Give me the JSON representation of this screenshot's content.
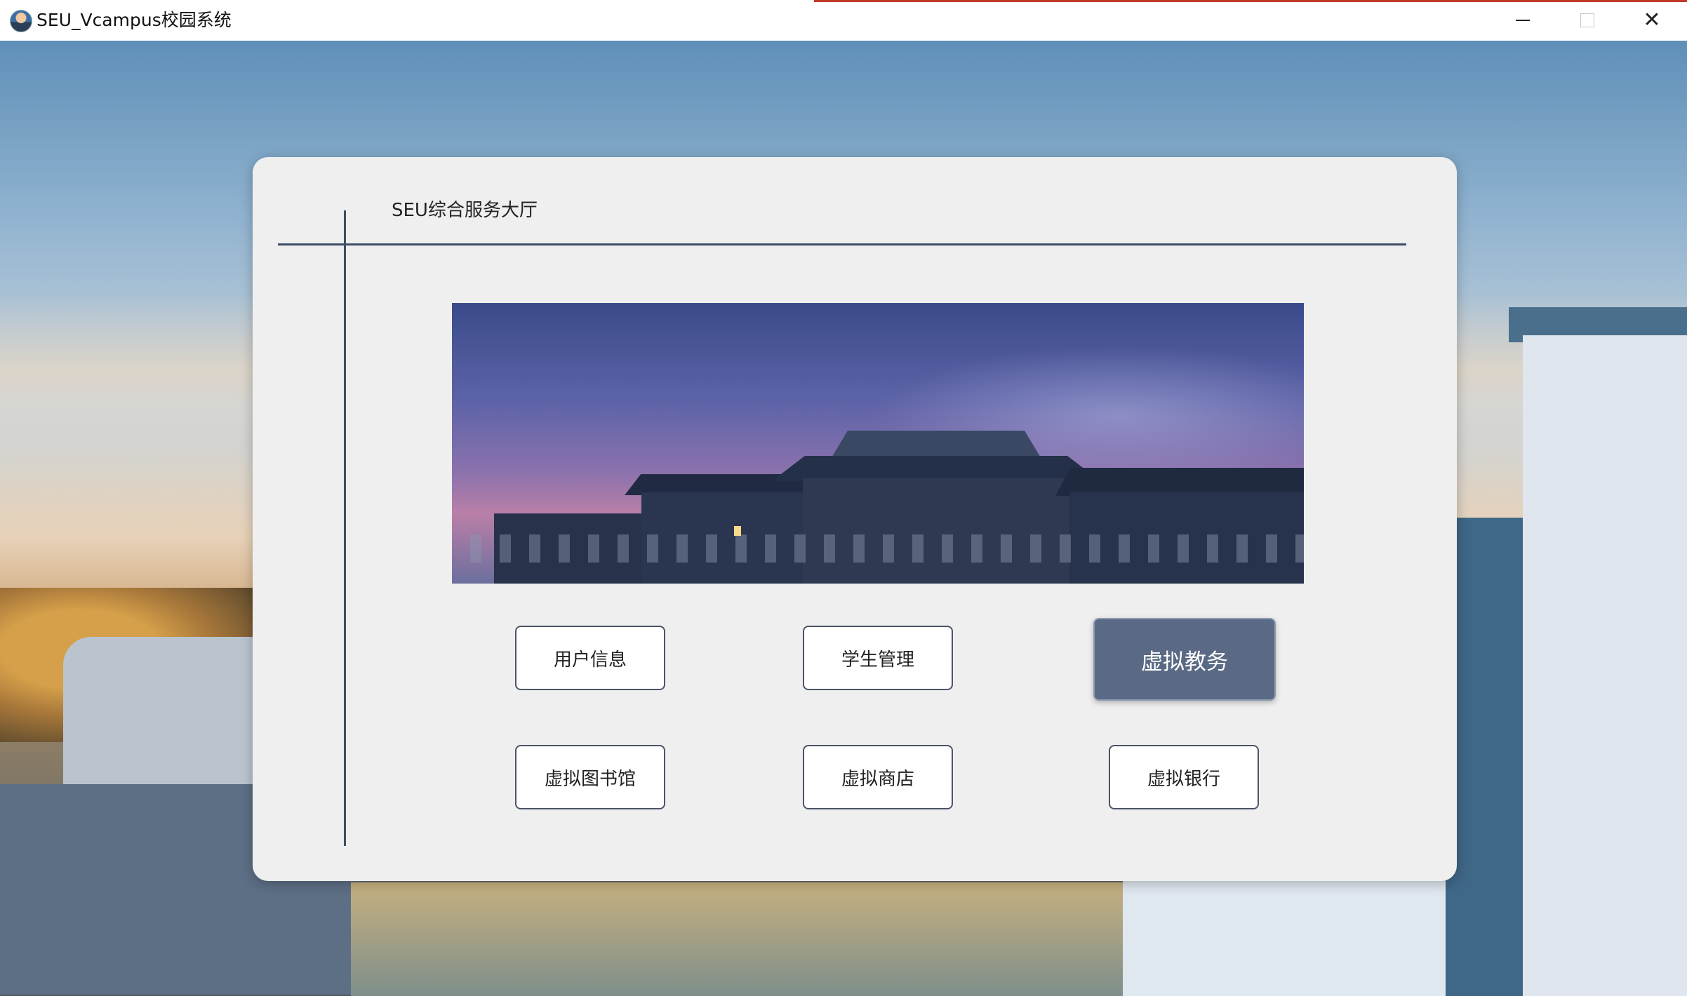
{
  "window": {
    "title": "SEU_Vcampus校园系统",
    "icon": "user-avatar-icon",
    "controls": {
      "minimize": "minimize-icon",
      "maximize": "maximize-icon",
      "close": "close-icon"
    }
  },
  "panel": {
    "title": "SEU综合服务大厅"
  },
  "menu": {
    "user_info": "用户信息",
    "student_management": "学生管理",
    "virtual_academic": "虚拟教务",
    "virtual_library": "虚拟图书馆",
    "virtual_shop": "虚拟商店",
    "virtual_bank": "虚拟银行"
  },
  "colors": {
    "accent_line": "#3e4d66",
    "active_button": "#5a6a85",
    "panel_bg": "#efefef"
  }
}
